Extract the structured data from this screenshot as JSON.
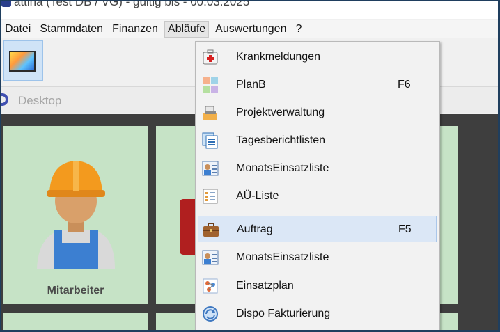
{
  "window": {
    "title": "attina (Test DB / VG)  - gültig bis - 00.03.2025"
  },
  "menubar": {
    "items": [
      {
        "label": "Datei",
        "accel": "D",
        "rest": "atei"
      },
      {
        "label": "Stammdaten"
      },
      {
        "label": "Finanzen"
      },
      {
        "label": "Abläufe",
        "active": true
      },
      {
        "label": "Auswertungen"
      },
      {
        "label": "?"
      }
    ]
  },
  "tabbar": {
    "desktop_label": "Desktop"
  },
  "tiles": {
    "mitarbeiter_label": "Mitarbeiter"
  },
  "dropdown": {
    "items": [
      {
        "label": "Krankmeldungen",
        "shortcut": "",
        "icon": "first-aid-kit-icon"
      },
      {
        "label": "PlanB",
        "shortcut": "F6",
        "icon": "color-grid-icon"
      },
      {
        "label": "Projektverwaltung",
        "shortcut": "",
        "icon": "printer-folder-icon"
      },
      {
        "label": "Tagesberichtlisten",
        "shortcut": "",
        "icon": "report-list-icon"
      },
      {
        "label": "MonatsEinsatzliste",
        "shortcut": "",
        "icon": "person-card-icon"
      },
      {
        "label": "AÜ-Liste",
        "shortcut": "",
        "icon": "document-list-icon"
      },
      {
        "label": "Auftrag",
        "shortcut": "F5",
        "icon": "briefcase-icon",
        "highlighted": true
      },
      {
        "label": "MonatsEinsatzliste",
        "shortcut": "",
        "icon": "person-card-icon"
      },
      {
        "label": "Einsatzplan",
        "shortcut": "",
        "icon": "plan-nodes-icon"
      },
      {
        "label": "Dispo Fakturierung",
        "shortcut": "",
        "icon": "refresh-globe-icon"
      }
    ]
  },
  "colors": {
    "tile_green": "#c6e3c6",
    "highlight": "#dbe7f6",
    "frame": "#1f3e5e"
  }
}
